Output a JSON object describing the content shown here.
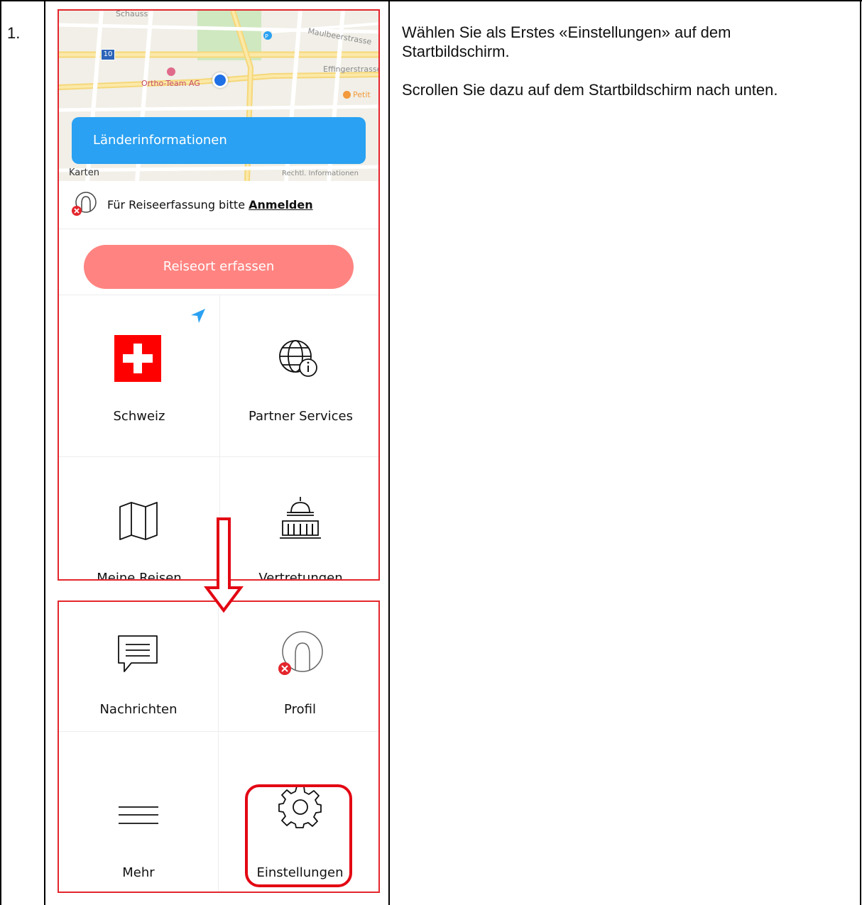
{
  "step": "1.",
  "instructions": {
    "paragraph1": "Wählen Sie als Erstes «Einstellungen» auf dem Startbildschirm.",
    "paragraph2": "Scrollen Sie dazu auf dem Startbildschirm nach unten."
  },
  "screen_top": {
    "map_labels": {
      "street1": "Maulbeerstrasse",
      "street2": "Effingerstrasse",
      "poi1": "Ortho-Team AG",
      "poi2": "Petit",
      "route_badge": "10",
      "map_attrib": "Karten",
      "legal": "Rechtl. Informationen",
      "top_street": "Schauss"
    },
    "country_info_button": "Länderinformationen",
    "login_prompt": "Für Reiseerfassung bitte",
    "login_link": "Anmelden",
    "record_location_button": "Reiseort erfassen",
    "tiles": [
      {
        "label": "Schweiz"
      },
      {
        "label": "Partner Services"
      },
      {
        "label": "Meine Reisen"
      },
      {
        "label": "Vertretungen"
      }
    ]
  },
  "screen_bottom": {
    "tiles": [
      {
        "label": "Nachrichten"
      },
      {
        "label": "Profil"
      },
      {
        "label": "Mehr"
      },
      {
        "label": "Einstellungen"
      }
    ]
  },
  "colors": {
    "frame_red": "#e3262c",
    "blue": "#2aa1f2",
    "pink": "#ff8481",
    "swiss_red": "#ff0000",
    "highlight": "#e30613"
  }
}
